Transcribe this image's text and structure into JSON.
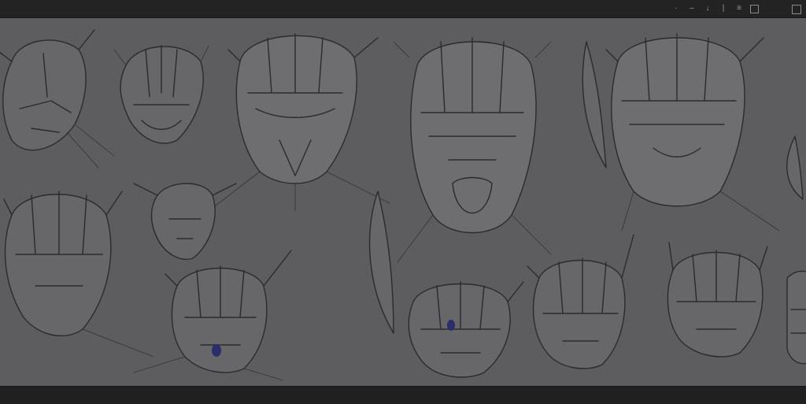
{
  "window": {
    "title": "",
    "toolbar_icons": [
      "dot-icon",
      "minus-icon",
      "pin-icon",
      "bar-icon",
      "list-icon",
      "square-icon"
    ]
  },
  "canvas": {
    "background": "#5d5d5f",
    "sketches": [
      "mask-sketch",
      "mask-sketch",
      "mask-sketch",
      "mask-sketch",
      "mask-sketch",
      "mask-sketch",
      "mask-sketch",
      "mask-sketch",
      "mask-sketch",
      "mask-sketch",
      "mask-sketch",
      "mask-sketch"
    ]
  },
  "status": {
    "caption_left": "",
    "caption_right": ""
  }
}
